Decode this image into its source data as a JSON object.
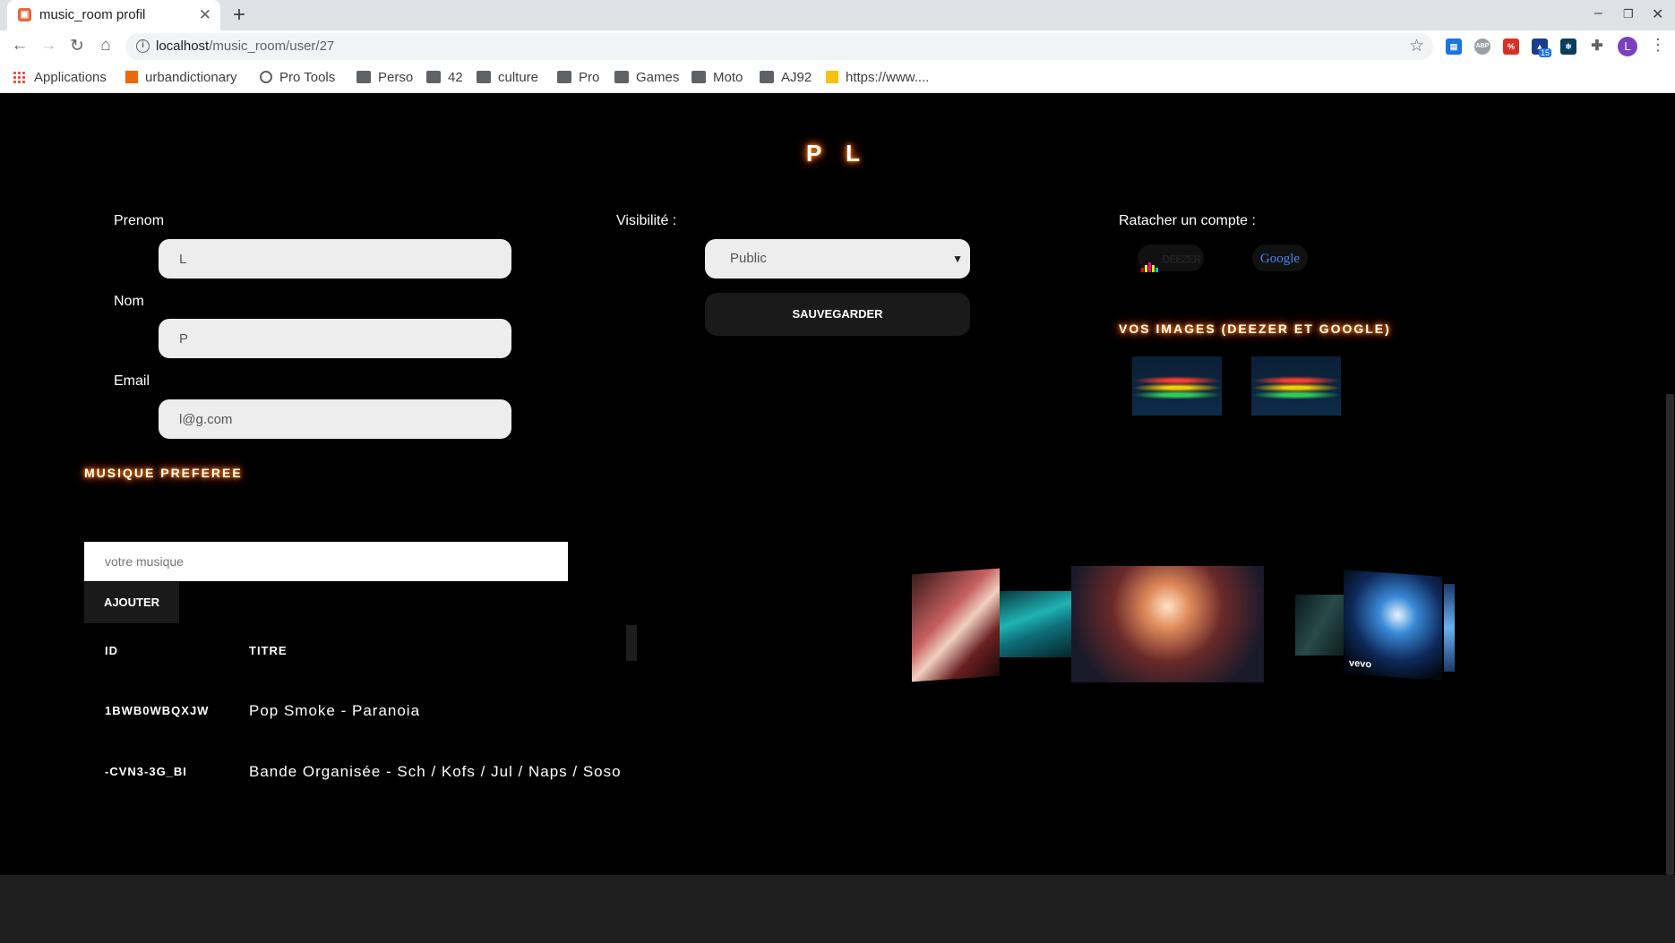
{
  "browser": {
    "tab_title": "music_room profil",
    "url_host": "localhost",
    "url_path": "/music_room/user/27",
    "profile_initial": "L",
    "extension_badge": "15",
    "bookmarks": [
      "Applications",
      "urbandictionary",
      "Pro Tools",
      "Perso",
      "42",
      "culture",
      "Pro",
      "Games",
      "Moto",
      "AJ92",
      "https://www...."
    ]
  },
  "profile": {
    "title": "P L",
    "prenom_label": "Prenom",
    "prenom_value": "L",
    "nom_label": "Nom",
    "nom_value": "P",
    "email_label": "Email",
    "email_value": "l@g.com",
    "visibility_label": "Visibilité :",
    "visibility_value": "Public",
    "save_label": "SAUVEGARDER",
    "link_account_label": "Ratacher un compte :",
    "deezer_label": "DEEZER",
    "google_label": "Google",
    "images_title": "VOS IMAGES (DEEZER ET GOOGLE)"
  },
  "music": {
    "section_title": "MUSIQUE PREFEREE",
    "input_placeholder": "votre musique",
    "add_label": "AJOUTER",
    "columns": [
      "ID",
      "TITRE"
    ],
    "rows": [
      {
        "id": "1BWB0WBQXJW",
        "title": "Pop Smoke - Paranoia"
      },
      {
        "id": "-CVN3-3G_BI",
        "title": "Bande Organisée - Sch / Kofs / Jul / Naps / Soso"
      }
    ]
  },
  "carousel": {
    "watermark": "vevo"
  },
  "colors": {
    "glow": "#ff6a00",
    "page_bg": "#000000",
    "button_bg": "#1a1a1a",
    "field_bg": "#ededed"
  }
}
